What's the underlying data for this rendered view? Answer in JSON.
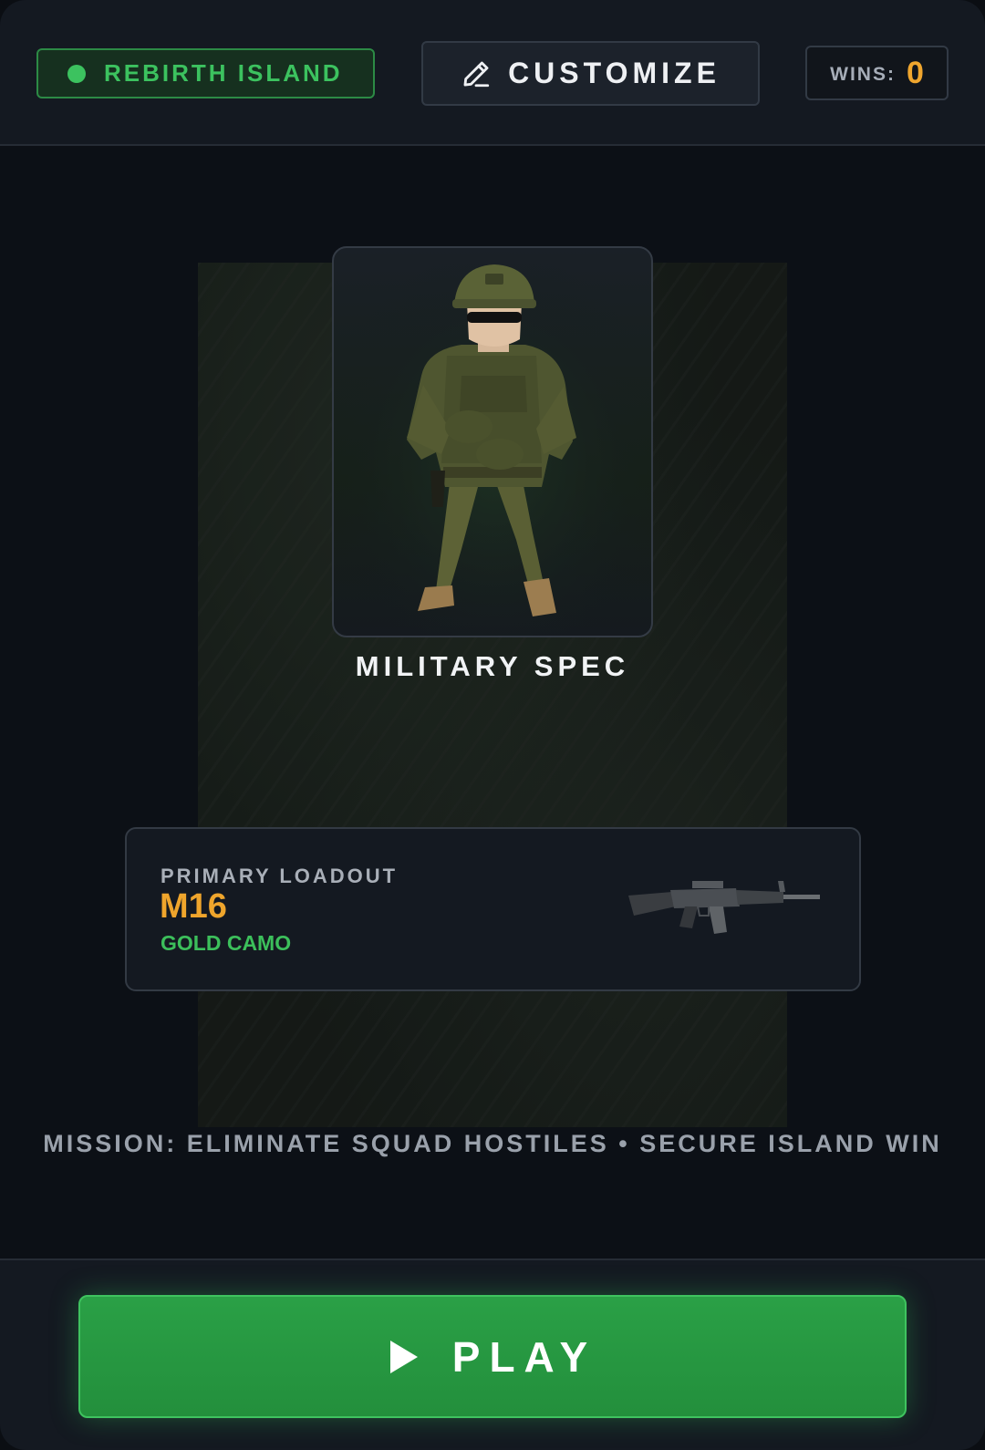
{
  "header": {
    "map": {
      "label": "REBIRTH ISLAND",
      "status_color": "#3cc25f",
      "icon": "status-dot"
    },
    "customize": {
      "label": "CUSTOMIZE",
      "icon": "pencil-icon"
    },
    "wins": {
      "label": "WINS:",
      "value": "0"
    }
  },
  "operator": {
    "name": "MILITARY SPEC",
    "portrait": "soldier-portrait"
  },
  "loadout": {
    "heading": "PRIMARY LOADOUT",
    "weapon": "M16",
    "camo": "GOLD CAMO",
    "weapon_image": "rifle-image"
  },
  "mission": {
    "text": "MISSION: ELIMINATE SQUAD HOSTILES • SECURE ISLAND WIN"
  },
  "footer": {
    "play": {
      "label": "PLAY",
      "icon": "play-icon"
    }
  },
  "colors": {
    "accent_green": "#3cc25f",
    "accent_gold": "#efa52c",
    "background": "#0c1016",
    "panel": "#141921"
  }
}
